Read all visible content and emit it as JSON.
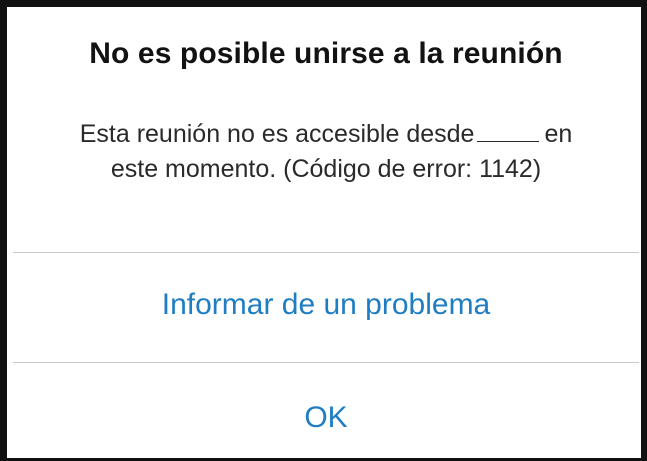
{
  "dialog": {
    "title": "No es posible unirse a la reunión",
    "message_part1": "Esta reunión no es accesible desde",
    "message_part2": "en",
    "message_line2": "este momento. (Código de error: 1142)",
    "report_label": "Informar de un problema",
    "ok_label": "OK"
  },
  "colors": {
    "action_blue": "#1f7dc1",
    "text": "#1a1a1a",
    "divider": "#c9c9c9"
  }
}
